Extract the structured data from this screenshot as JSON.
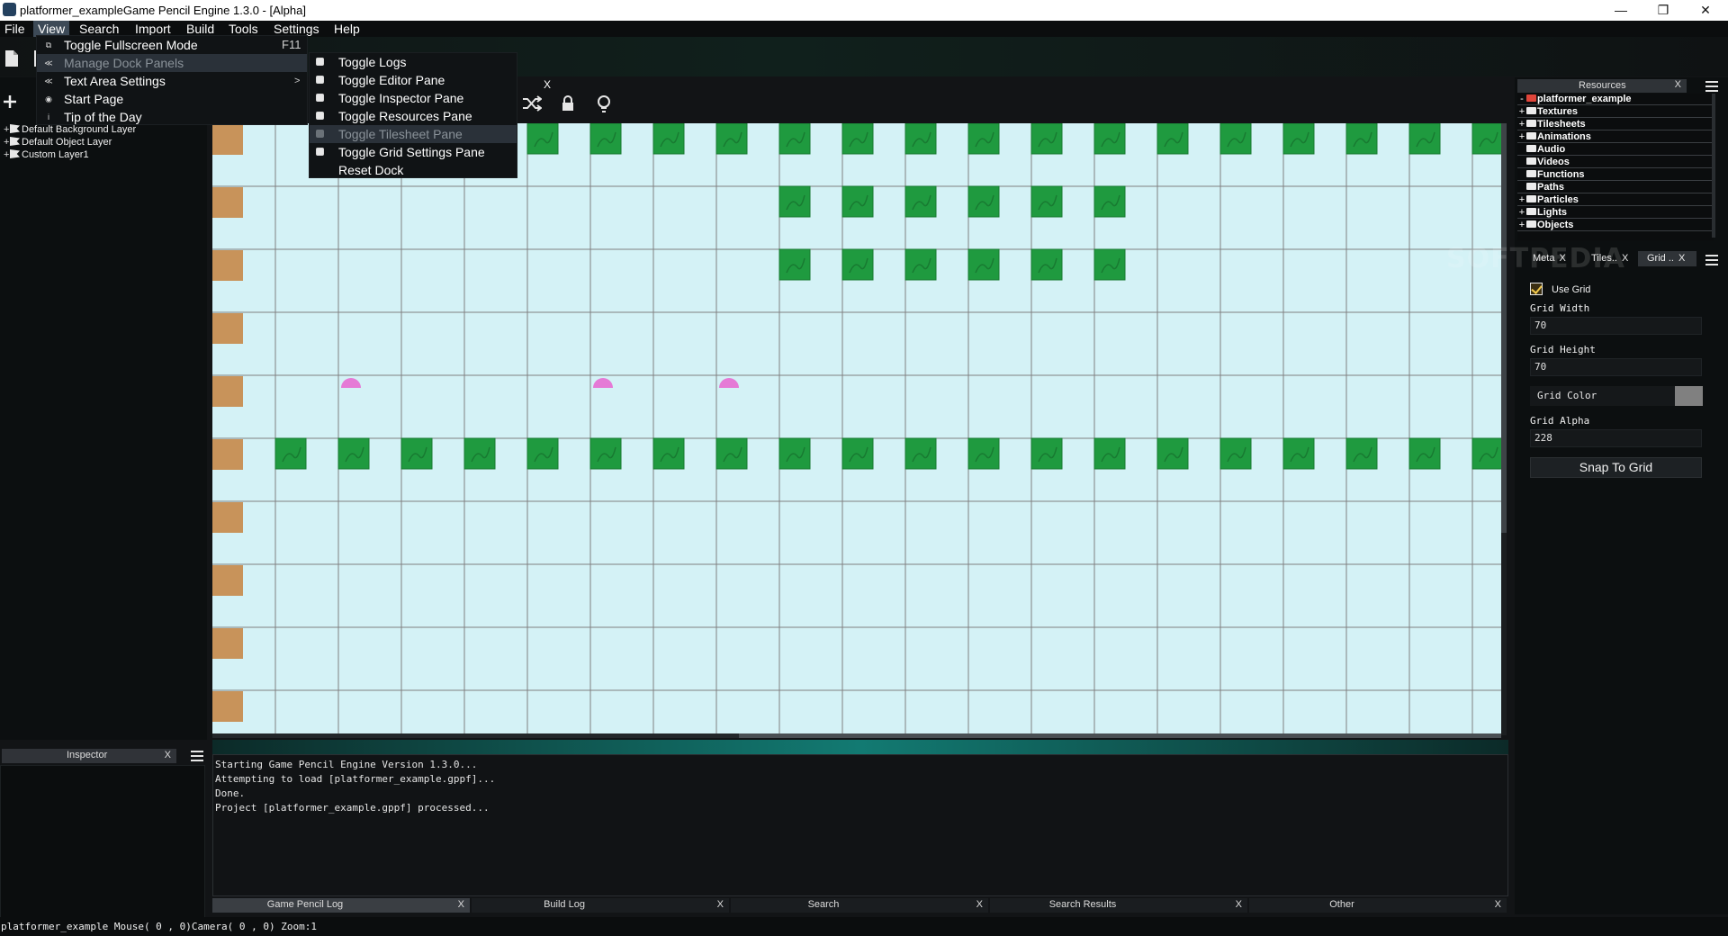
{
  "window": {
    "title": "platformer_exampleGame Pencil Engine  1.3.0 - [Alpha]",
    "minimize_glyph": "—",
    "maximize_glyph": "❐",
    "close_glyph": "✕"
  },
  "menubar": [
    "File",
    "View",
    "Search",
    "Import",
    "Build",
    "Tools",
    "Settings",
    "Help"
  ],
  "view_menu": {
    "items": [
      {
        "icon": "fullscreen-icon",
        "glyph": "⧉",
        "label": "Toggle Fullscreen Mode",
        "shortcut": "F11"
      },
      {
        "icon": "dock-icon",
        "glyph": "≪",
        "label": "Manage Dock Panels",
        "arrow": "",
        "hover": true
      },
      {
        "icon": "text-settings-icon",
        "glyph": "≪",
        "label": "Text Area Settings",
        "arrow": ">"
      },
      {
        "icon": "start-page-icon",
        "glyph": "◉",
        "label": "Start Page"
      },
      {
        "icon": "info-icon",
        "glyph": "i",
        "label": "Tip of the Day"
      }
    ]
  },
  "dock_submenu": {
    "items": [
      {
        "label": "Toggle Logs"
      },
      {
        "label": "Toggle Editor Pane"
      },
      {
        "label": "Toggle Inspector Pane"
      },
      {
        "label": "Toggle Resources Pane"
      },
      {
        "label": "Toggle Tilesheet Pane",
        "hover": true
      },
      {
        "label": "Toggle Grid Settings Pane"
      },
      {
        "label": "Reset Dock",
        "no_icon": true
      }
    ]
  },
  "editor_tab_close": "X",
  "layers": {
    "items": [
      {
        "label": "Default Background Layer"
      },
      {
        "label": "Default Object Layer"
      },
      {
        "label": "Custom Layer1"
      }
    ]
  },
  "inspector": {
    "title": "Inspector",
    "close": "X"
  },
  "resources": {
    "title": "Resources",
    "close": "X",
    "items": [
      {
        "exp": "-",
        "label": "platformer_example",
        "root": true
      },
      {
        "exp": "+",
        "label": "Textures"
      },
      {
        "exp": "+",
        "label": "Tilesheets"
      },
      {
        "exp": "+",
        "label": "Animations"
      },
      {
        "exp": "",
        "label": "Audio"
      },
      {
        "exp": "",
        "label": "Videos"
      },
      {
        "exp": "",
        "label": "Functions"
      },
      {
        "exp": "",
        "label": "Paths"
      },
      {
        "exp": "+",
        "label": "Particles"
      },
      {
        "exp": "+",
        "label": "Lights"
      },
      {
        "exp": "+",
        "label": "Objects"
      }
    ]
  },
  "pane_tabs": [
    {
      "label": "Meta",
      "close": "X"
    },
    {
      "label": "Tiles..",
      "close": "X"
    },
    {
      "label": "Grid ..",
      "close": "X"
    }
  ],
  "grid_settings": {
    "use_grid_label": "Use Grid",
    "grid_width_label": "Grid Width",
    "grid_width_value": "70",
    "grid_height_label": "Grid Height",
    "grid_height_value": "70",
    "grid_color_label": "Grid Color",
    "grid_color_value": "#808080",
    "grid_alpha_label": "Grid Alpha",
    "grid_alpha_value": "228",
    "snap_button": "Snap To Grid"
  },
  "watermark": "SOFTPEDIA",
  "log": {
    "lines": [
      "Starting Game Pencil Engine Version 1.3.0...",
      "Attempting to load [platformer_example.gppf]...",
      "Done.",
      "Project [platformer_example.gppf] processed..."
    ],
    "tabs": [
      {
        "label": "Game Pencil Log",
        "close": "X",
        "active": true
      },
      {
        "label": "Build Log",
        "close": "X"
      },
      {
        "label": "Search",
        "close": "X"
      },
      {
        "label": "Search Results",
        "close": "X"
      },
      {
        "label": "Other",
        "close": "X"
      }
    ]
  },
  "statusbar": "platformer_example Mouse( 0 , 0)Camera( 0 , 0) Zoom:1",
  "scene": {
    "cols": 21,
    "rows": 10,
    "crate_col": 0,
    "grass_rows": [
      {
        "row": 0,
        "from": 1,
        "to": 20,
        "skip": [
          1,
          2,
          3,
          4
        ]
      },
      {
        "row": 1,
        "from": 9,
        "to": 14
      },
      {
        "row": 2,
        "from": 9,
        "to": 14
      },
      {
        "row": 5,
        "from": 1,
        "to": 20
      }
    ],
    "enemies": [
      [
        2,
        4
      ],
      [
        6,
        4
      ],
      [
        8,
        4
      ]
    ],
    "colors": {
      "background": "#d4f2f6",
      "grid": "#808080",
      "grass": "#1f9a3f",
      "grass_edge": "#187a31",
      "crate": "#c8935a",
      "enemy": "#e57ad6"
    }
  }
}
